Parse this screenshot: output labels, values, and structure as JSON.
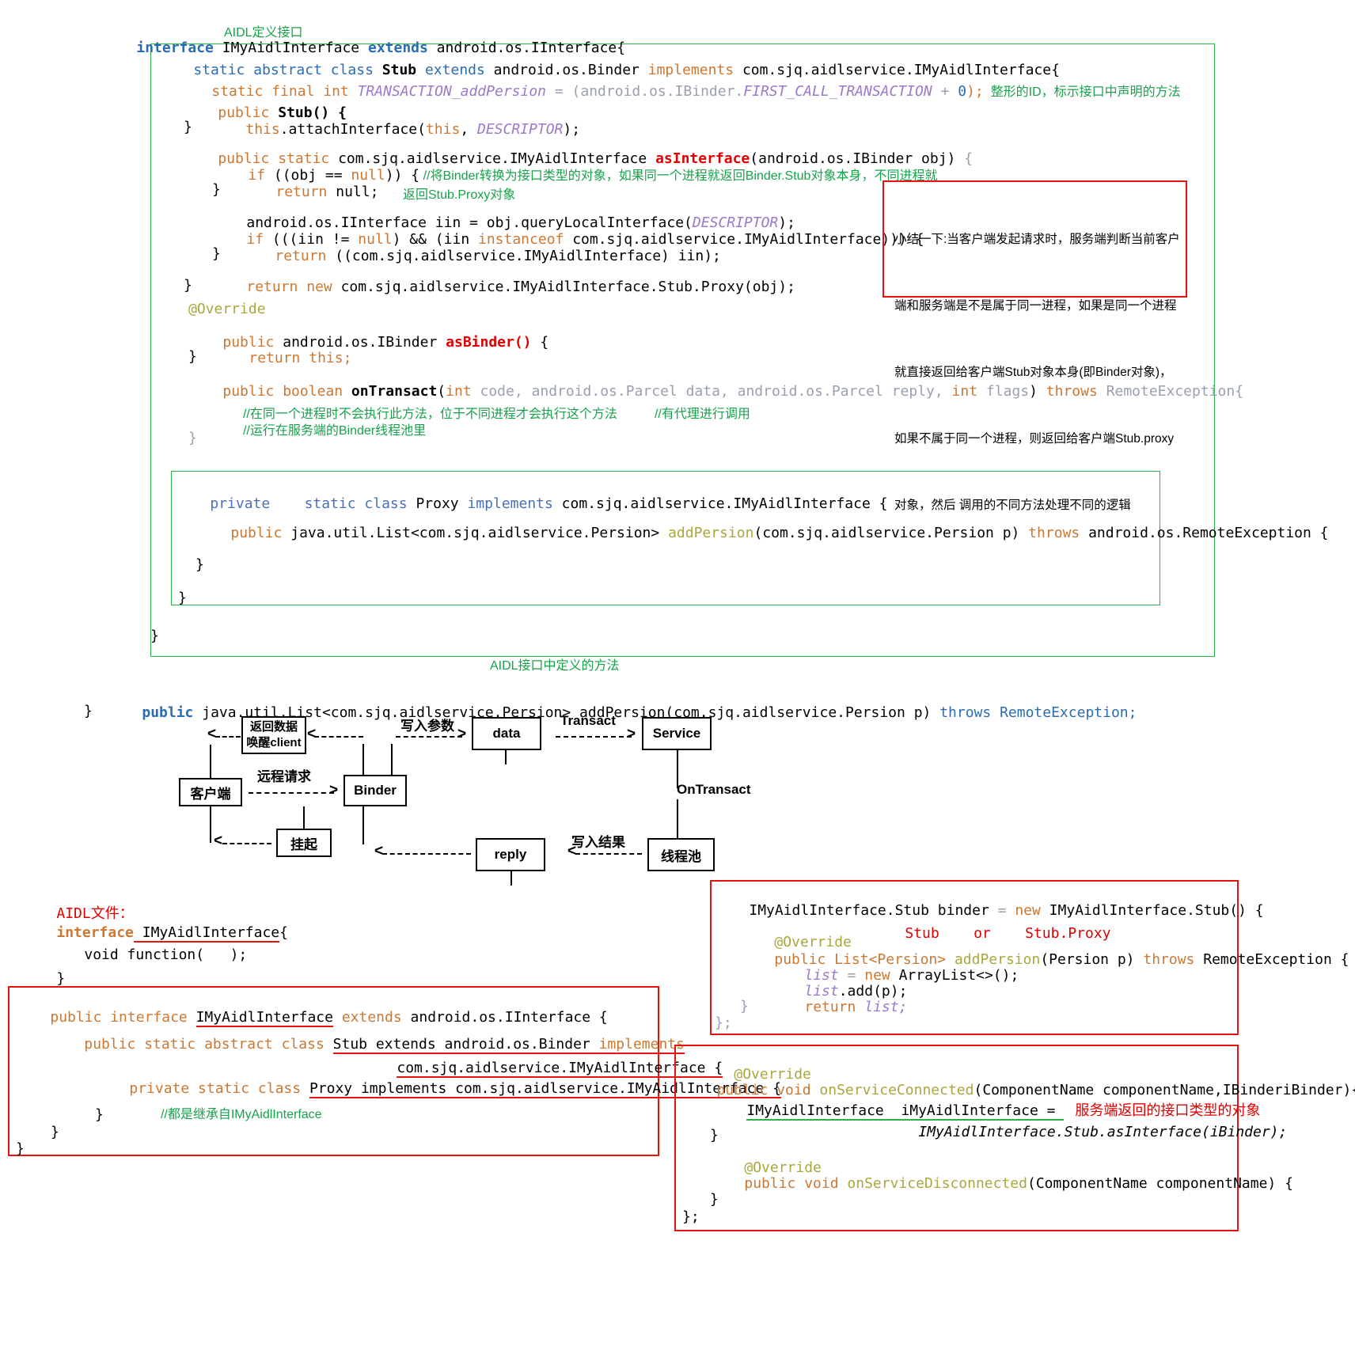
{
  "top": {
    "title_comment": "AIDL定义接口",
    "interface_line": {
      "kw": "interface",
      "name": " IMyAidlInterface ",
      "extends": "extends",
      "rest": " android.os.IInterface{"
    },
    "stub_header": {
      "a": "static abstract class",
      "b": " Stub ",
      "c": "extends",
      "d": " android.os.Binder ",
      "e": "implements",
      "f": " com.sjq.aidlservice.IMyAidlInterface{"
    },
    "transaction_line": {
      "a": "static final int ",
      "b": "TRANSACTION_addPersion",
      "c": " = ",
      "d": "(android.os.IBinder.",
      "e": "FIRST_CALL_TRANSACTION",
      "f": " + ",
      "g": "0",
      "h": ");",
      "comment": "  整形的ID，标示接口中声明的方法"
    },
    "ctor": {
      "l1_kw": "public",
      "l1_rest": " Stub() {",
      "l2_a": "this",
      "l2_b": ".attachInterface(",
      "l2_c": "this",
      "l2_d": ", ",
      "l2_e": "DESCRIPTOR",
      "l2_f": ");",
      "l3": "}"
    },
    "as_interface": {
      "kw": "public static",
      "type": " com.sjq.aidlservice.IMyAidlInterface ",
      "name": "asInterface",
      "args_open": "(",
      "args": "android.os.IBinder obj",
      "args_close": ") ",
      "brace": "{"
    },
    "if_null": {
      "kw": "if",
      "a": " ((obj == ",
      "b": "null",
      "c": ")) ",
      "d": "{",
      "comment": " //将Binder转换为接口类型的对象，如果同一个进程就返回Binder.Stub对象本身，不同进程就"
    },
    "return_null": {
      "kw": "return",
      "v": " null;"
    },
    "comment_proxy": "返回Stub.Proxy对象",
    "close1": "}",
    "iin_line": "android.os.IInterface iin = obj.queryLocalInterface(DESCRIPTOR);",
    "iin_parts": {
      "a": "android.os.IInterface iin = obj.queryLocalInterface(",
      "b": "DESCRIPTOR",
      "c": ");"
    },
    "if_instanceof": {
      "kw": "if",
      "a": " (((iin != ",
      "b": "null",
      "c": ") && (iin ",
      "d": "instanceof",
      "e": " com.sjq.aidlservice.IMyAidlInterface))) {"
    },
    "return_iin": {
      "kw": "return",
      "v": " ((com.sjq.aidlservice.IMyAidlInterface) iin);"
    },
    "close2": "}",
    "return_proxy": {
      "kw": "return",
      "kw2": " new",
      "v": " com.sjq.aidlservice.IMyAidlInterface.Stub.Proxy(obj);"
    },
    "close3": "}",
    "override1": "@Override",
    "as_binder": {
      "kw": "public",
      "type": " android.os.IBinder ",
      "name": "asBinder()",
      "brace": " {"
    },
    "return_this": {
      "kw": "return",
      "v": " this;"
    },
    "close4": "}",
    "on_transact": {
      "kw": "public boolean ",
      "name": "onTransact",
      "p_open": "(",
      "p1": "int",
      "p1n": " code, ",
      "p2": "android.os.Parcel",
      "p2n": " data, ",
      "p3": "android.os.Parcel",
      "p3n": " reply, ",
      "p4": "int",
      "p4n": " flags",
      "p_close": ") ",
      "throws": "throws",
      "exc": " RemoteException{"
    },
    "tc1": "//在同一个进程时不会执行此方法，位于不同进程才会执行这个方法",
    "tc2": "//有代理进行调用",
    "tc3": "//运行在服务端的Binder线程池里",
    "close5": "}",
    "close_outer": "}",
    "footer_comment": "AIDL接口中定义的方法"
  },
  "note_box": {
    "lines": [
      "小结一下:当客户端发起请求时，服务端判断当前客户",
      "端和服务端是不是属于同一进程，如果是同一个进程",
      "就直接返回给客户端Stub对象本身(即Binder对象)，",
      "如果不属于同一个进程，则返回给客户端Stub.proxy",
      "对象，然后 调用的不同方法处理不同的逻辑"
    ]
  },
  "proxy_box": {
    "header": {
      "a": "private",
      "b": "    static class",
      "c": " Proxy ",
      "d": "implements",
      "e": " com.sjq.aidlservice.IMyAidlInterface {"
    },
    "method": {
      "a": "public",
      "b": " java.util.List<com.sjq.aidlservice.Persion> ",
      "c": "addPersion",
      "d": "(com.sjq.aidlservice.Persion p) ",
      "e": "throws",
      "f": " android.os.RemoteException {"
    },
    "close1": "}",
    "close2": "}"
  },
  "method_decl": {
    "kw": "public",
    "sig": " java.util.List<com.sjq.aidlservice.Persion> addPersion(com.sjq.aidlservice.Persion p) ",
    "throws": "throws",
    "exc": " RemoteException;"
  },
  "diagram": {
    "boxes": {
      "client": "客户端",
      "return_data_l1": "返回数据",
      "return_data_l2": "唤醒client",
      "binder": "Binder",
      "suspend": "挂起",
      "data": "data",
      "reply": "reply",
      "service": "Service",
      "threadpool": "线程池"
    },
    "labels": {
      "remote_request": "远程请求",
      "write_param": "写入参数",
      "transact": "Transact",
      "on_transact": "OnTransact",
      "write_result": "写入结果"
    }
  },
  "aidl_file": {
    "title": "AIDL文件：",
    "interface_kw": "interface",
    "interface_name": " IMyAidlInterface",
    "interface_brace": "{",
    "body": "void function(   );",
    "close": "}"
  },
  "left_red_box": {
    "l1_a": "public interface ",
    "l1_b": "IMyAidlInterface",
    "l1_c": " extends",
    "l1_d": " android.os.IInterface {",
    "l2_a": "public static abstract class ",
    "l2_b": "Stub extends",
    "l2_c": " android.os.Binder ",
    "l2_d": "implements",
    "l3": "com.sjq.aidlservice.IMyAidlInterface {",
    "l4_a": "private static class ",
    "l4_b": "Proxy implements",
    "l4_c": " com.sjq.aidlservice.IMyAidlInterface {",
    "comment": "//都是继承自IMyAidlInterface",
    "c1": "}",
    "c2": "}",
    "c3": "}"
  },
  "right_red_box1": {
    "l1_a": "IMyAidlInterface.Stub binder ",
    "l1_b": "= ",
    "l1_c": "new",
    "l1_d": " IMyAidlInterface.Stub() {",
    "annot_stub": "Stub",
    "annot_or": "or",
    "annot_proxy": "Stub.Proxy",
    "override": "@Override",
    "l2_a": "public List<Persion> ",
    "l2_b": "addPersion",
    "l2_c": "(Persion p) ",
    "l2_d": "throws",
    "l2_e": " RemoteException {",
    "l3_a": "list",
    "l3_b": " = ",
    "l3_c": "new",
    "l3_d": " ArrayList<>();",
    "l4_a": "list",
    "l4_b": ".add(p);",
    "l5_a": "return",
    "l5_b": " list;",
    "c1": "}",
    "c2": "};"
  },
  "right_red_box2": {
    "override1": "@Override",
    "l1_a": "public void ",
    "l1_b": "onServiceConnected",
    "l1_c": "(ComponentName componentName,IBinderiBinder){",
    "l2_a": "IMyAidlInterface  iMyAidlInterface = ",
    "l2_note": "服务端返回的接口类型的对象",
    "l3": "IMyAidlInterface.Stub.asInterface(iBinder);",
    "c1": "}",
    "override2": "@Override",
    "l4_a": "public void ",
    "l4_b": "onServiceDisconnected",
    "l4_c": "(ComponentName componentName) {",
    "c2": "}",
    "c3": "};"
  },
  "colors": {
    "green_border": "#2bb34a",
    "red_border": "#e8130f",
    "keyword": "#cc7832",
    "comment_green": "#17a24a",
    "accent_red": "#e00000"
  }
}
